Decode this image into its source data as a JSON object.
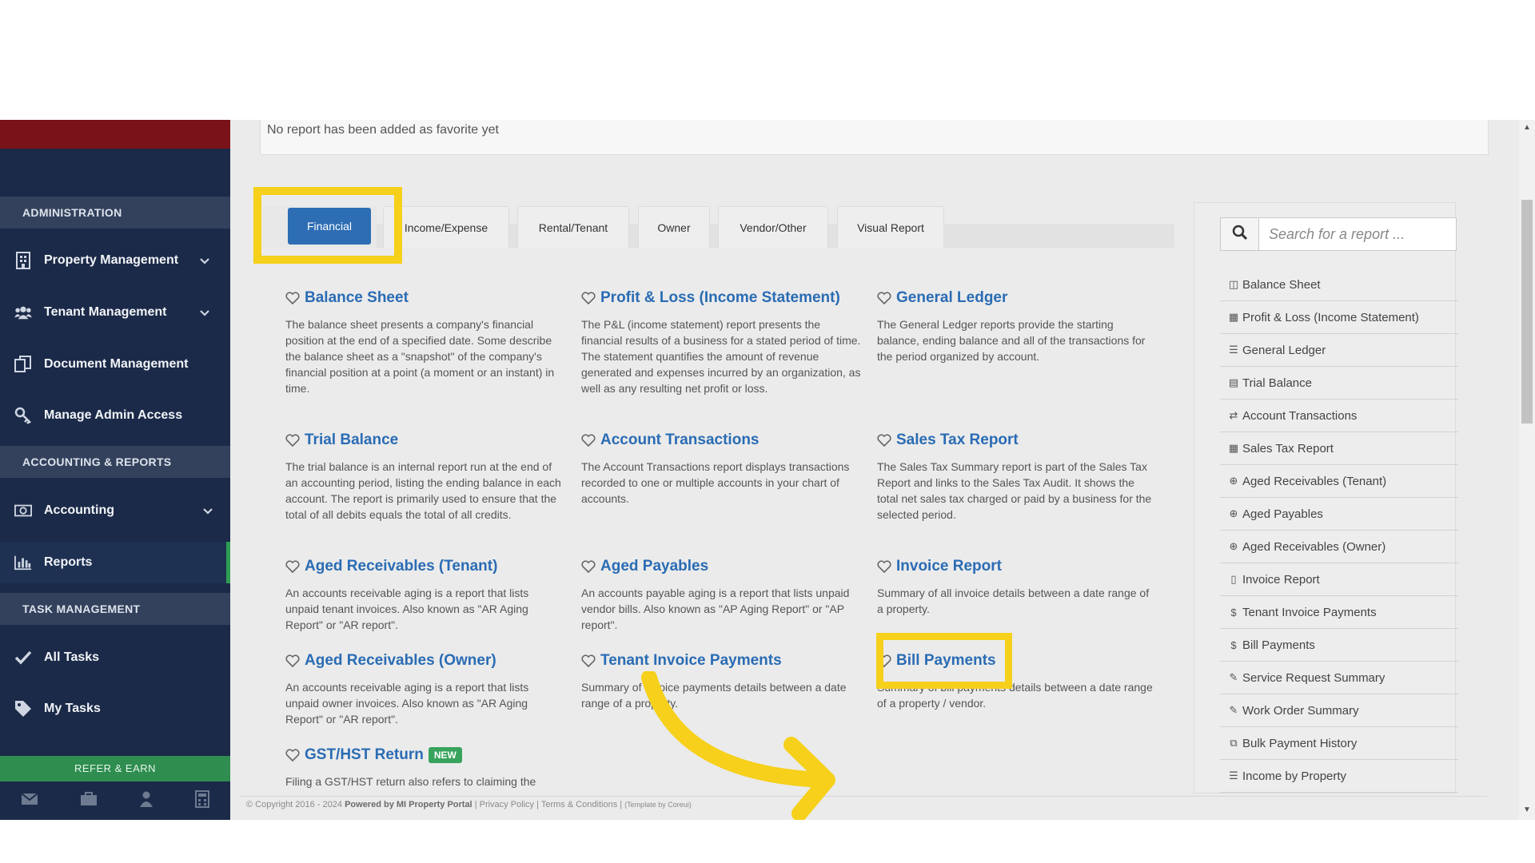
{
  "sidebar": {
    "sections": [
      "ADMINISTRATION",
      "ACCOUNTING & REPORTS",
      "TASK MANAGEMENT"
    ],
    "items": [
      {
        "label": "Property Management",
        "icon": "building-icon"
      },
      {
        "label": "Tenant Management",
        "icon": "users-icon"
      },
      {
        "label": "Document Management",
        "icon": "documents-icon"
      },
      {
        "label": "Manage Admin Access",
        "icon": "key-icon"
      },
      {
        "label": "Accounting",
        "icon": "money-icon"
      },
      {
        "label": "Reports",
        "icon": "bar-chart-icon"
      },
      {
        "label": "All Tasks",
        "icon": "check-icon"
      },
      {
        "label": "My Tasks",
        "icon": "tag-icon"
      }
    ],
    "refer_label": "REFER & EARN",
    "bottom_icons": [
      "mail-icon",
      "briefcase-icon",
      "user-icon",
      "calculator-icon"
    ]
  },
  "favorites": {
    "empty_text": "No report has been added as favorite yet"
  },
  "tabs": [
    {
      "label": "Financial",
      "active": true
    },
    {
      "label": "Income/Expense"
    },
    {
      "label": "Rental/Tenant"
    },
    {
      "label": "Owner"
    },
    {
      "label": "Vendor/Other"
    },
    {
      "label": "Visual Report"
    }
  ],
  "reports": [
    {
      "title": "Balance Sheet",
      "desc": "The balance sheet presents a company's financial position at the end of a specified date. Some describe the balance sheet as a \"snapshot\" of the company's financial position at a point (a moment or an instant) in time."
    },
    {
      "title": "Profit & Loss (Income Statement)",
      "desc": "The P&L (income statement) report presents the financial results of a business for a stated period of time. The statement quantifies the amount of revenue generated and expenses incurred by an organization, as well as any resulting net profit or loss."
    },
    {
      "title": "General Ledger",
      "desc": "The General Ledger reports provide the starting balance, ending balance and all of the transactions for the period organized by account."
    },
    {
      "title": "Trial Balance",
      "desc": "The trial balance is an internal report run at the end of an accounting period, listing the ending balance in each account. The report is primarily used to ensure that the total of all debits equals the total of all credits."
    },
    {
      "title": "Account Transactions",
      "desc": "The Account Transactions report displays transactions recorded to one or multiple accounts in your chart of accounts."
    },
    {
      "title": "Sales Tax Report",
      "desc": "The Sales Tax Summary report is part of the Sales Tax Report and links to the Sales Tax Audit. It shows the total net sales tax charged or paid by a business for the selected period."
    },
    {
      "title": "Aged Receivables (Tenant)",
      "desc": "An accounts receivable aging is a report that lists unpaid tenant invoices. Also known as \"AR Aging Report\" or \"AR report\"."
    },
    {
      "title": "Aged Payables",
      "desc": "An accounts payable aging is a report that lists unpaid vendor bills. Also known as \"AP Aging Report\" or \"AP report\"."
    },
    {
      "title": "Invoice Report",
      "desc": "Summary of all invoice details between a date range of a property."
    },
    {
      "title": "Aged Receivables (Owner)",
      "desc": "An accounts receivable aging is a report that lists unpaid owner invoices. Also known as \"AR Aging Report\" or \"AR report\"."
    },
    {
      "title": "Tenant Invoice Payments",
      "desc": "Summary of invoice payments details between a date range of a property."
    },
    {
      "title": "Bill Payments",
      "desc": "Summary of bill payments details between a date range of a property / vendor."
    },
    {
      "title": "GST/HST Return",
      "desc": "Filing a GST/HST return also refers to claiming the",
      "badge": "NEW"
    }
  ],
  "search": {
    "placeholder": "Search for a report ..."
  },
  "quick_list": [
    {
      "label": "Balance Sheet",
      "glyph": "◫"
    },
    {
      "label": "Profit & Loss (Income Statement)",
      "glyph": "▦"
    },
    {
      "label": "General Ledger",
      "glyph": "☰"
    },
    {
      "label": "Trial Balance",
      "glyph": "▤"
    },
    {
      "label": "Account Transactions",
      "glyph": "⇄"
    },
    {
      "label": "Sales Tax Report",
      "glyph": "▦"
    },
    {
      "label": "Aged Receivables (Tenant)",
      "glyph": "⊕"
    },
    {
      "label": "Aged Payables",
      "glyph": "⊕"
    },
    {
      "label": "Aged Receivables (Owner)",
      "glyph": "⊕"
    },
    {
      "label": "Invoice Report",
      "glyph": "▯"
    },
    {
      "label": "Tenant Invoice Payments",
      "glyph": "$"
    },
    {
      "label": "Bill Payments",
      "glyph": "$"
    },
    {
      "label": "Service Request Summary",
      "glyph": "✎"
    },
    {
      "label": "Work Order Summary",
      "glyph": "✎"
    },
    {
      "label": "Bulk Payment History",
      "glyph": "⧉"
    },
    {
      "label": "Income by Property",
      "glyph": "☰"
    }
  ],
  "footer": {
    "copyright": "© Copyright 2016 - 2024",
    "powered": "Powered by MI Property Portal",
    "links": "| Privacy Policy | Terms & Conditions |",
    "template": "(Template by Coreui)"
  },
  "colors": {
    "sidebar": "#1b2a48",
    "accent": "#2d6db4",
    "highlight": "#f6d01b",
    "refer": "#2e8d4f"
  }
}
